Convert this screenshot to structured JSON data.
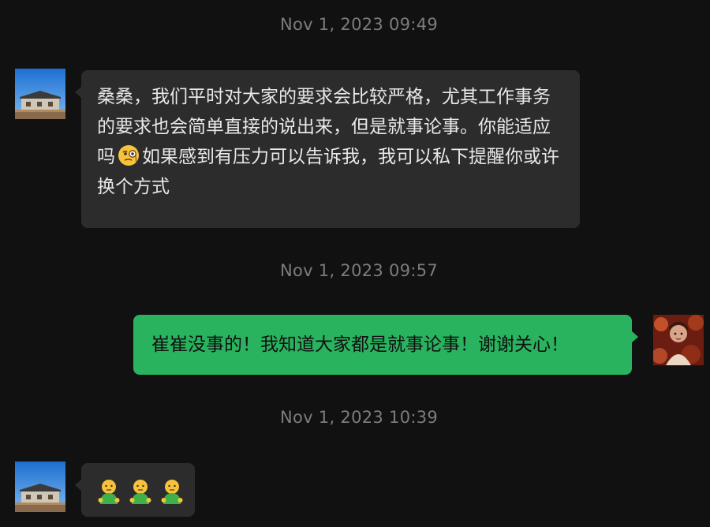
{
  "timestamps": [
    "Nov 1, 2023 09:49",
    "Nov 1, 2023 09:57",
    "Nov 1, 2023 10:39"
  ],
  "messages": [
    {
      "direction": "incoming",
      "text_part1": "桑桑，我们平时对大家的要求会比较严格，尤其工作事务的要求也会简单直接的说出来，但是就事论事。你能适应吗",
      "emoji": "face-with-monocle",
      "text_part2": "如果感到有压力可以告诉我，我可以私下提醒你或许换个方式"
    },
    {
      "direction": "outgoing",
      "text": "崔崔没事的！我知道大家都是就事论事！谢谢关心！"
    },
    {
      "direction": "incoming",
      "emojis": [
        "person-standing-emoji",
        "person-standing-emoji",
        "person-standing-emoji"
      ]
    }
  ],
  "colors": {
    "background": "#111111",
    "incoming_bubble": "#2c2c2c",
    "outgoing_bubble": "#29b35f",
    "timestamp": "#7c7c7c"
  }
}
